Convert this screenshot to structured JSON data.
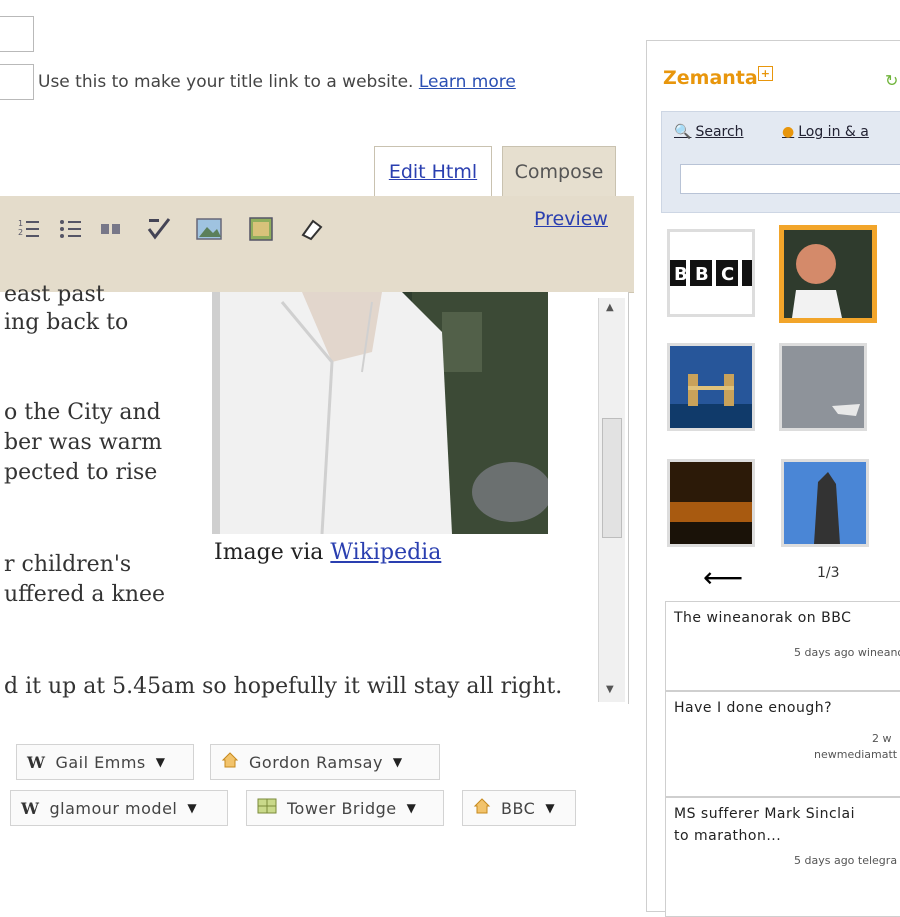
{
  "title_fields": {
    "link_hint": "Use this to make your title link to a website.",
    "learn_more": "Learn more"
  },
  "tabs": {
    "edit_html": "Edit Html",
    "compose": "Compose"
  },
  "toolbar": {
    "preview": "Preview",
    "icons": [
      "numbered-list-icon",
      "bullet-list-icon",
      "blockquote-icon",
      "spellcheck-icon",
      "insert-image-icon",
      "insert-video-icon",
      "remove-formatting-icon"
    ]
  },
  "editor": {
    "lines": [
      "east past",
      "ing back to",
      "o the City and",
      "ber was warm",
      "pected to rise",
      "r children's",
      "uffered a knee",
      "d it up at 5.45am so hopefully it will stay all right."
    ],
    "caption_prefix": "Image via",
    "caption_link": "Wikipedia"
  },
  "tags": [
    {
      "icon": "W",
      "label": "Gail Emms"
    },
    {
      "icon": "house-icon",
      "label": "Gordon Ramsay"
    },
    {
      "icon": "W",
      "label": "glamour model"
    },
    {
      "icon": "map-icon",
      "label": "Tower Bridge"
    },
    {
      "icon": "house-icon",
      "label": "BBC"
    }
  ],
  "zemanta": {
    "brand": "Zemanta",
    "search_tab": "Search",
    "login_tab": "Log in & a",
    "pager": "1/3",
    "articles": [
      {
        "title": "The wineanorak on BBC",
        "meta": "5 days ago wineano"
      },
      {
        "title": "Have I done enough?",
        "meta_top": "2 w",
        "meta": "newmediamatt"
      },
      {
        "title": "MS sufferer Mark Sinclai",
        "title2": "to marathon...",
        "meta": "5 days ago telegra"
      }
    ]
  },
  "colors": {
    "link": "#2a3fb0",
    "toolbar_bg": "#e4dccb",
    "zemanta_orange": "#e8960c",
    "selected_thumb_border": "#f2a52a"
  }
}
